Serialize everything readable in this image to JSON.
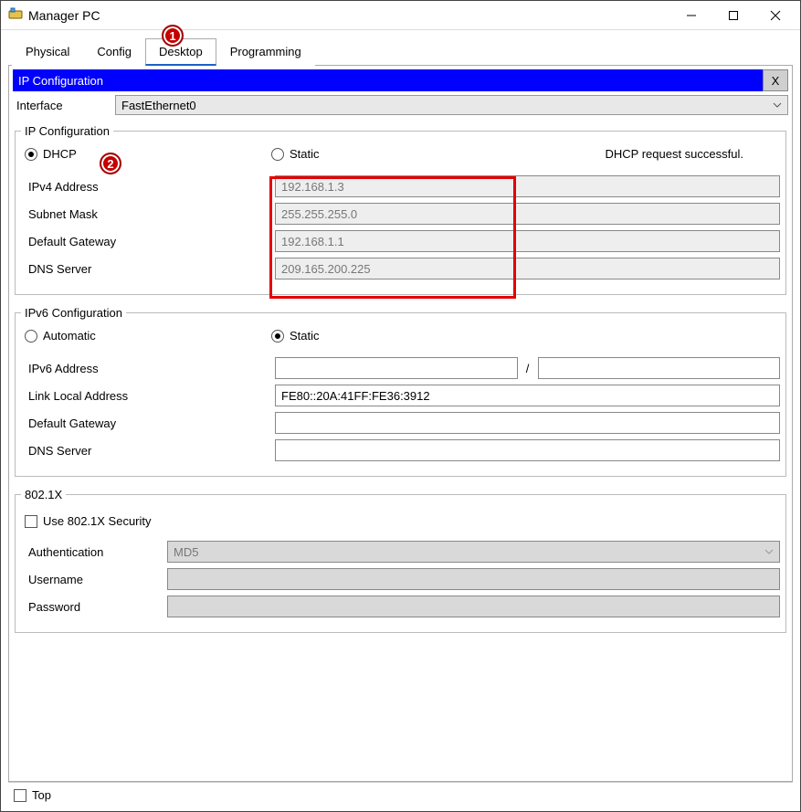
{
  "window": {
    "title": "Manager PC"
  },
  "tabs": {
    "items": [
      "Physical",
      "Config",
      "Desktop",
      "Programming"
    ],
    "active_index": 2
  },
  "bluebar": {
    "title": "IP Configuration",
    "close": "X"
  },
  "interface": {
    "label": "Interface",
    "value": "FastEthernet0"
  },
  "ipconfig": {
    "legend": "IP Configuration",
    "mode_dhcp": "DHCP",
    "mode_static": "Static",
    "mode_selected": "dhcp",
    "status": "DHCP request successful.",
    "fields": {
      "ipv4_label": "IPv4 Address",
      "ipv4_value": "192.168.1.3",
      "mask_label": "Subnet Mask",
      "mask_value": "255.255.255.0",
      "gw_label": "Default Gateway",
      "gw_value": "192.168.1.1",
      "dns_label": "DNS Server",
      "dns_value": "209.165.200.225"
    }
  },
  "ipv6": {
    "legend": "IPv6 Configuration",
    "mode_auto": "Automatic",
    "mode_static": "Static",
    "mode_selected": "static",
    "addr_label": "IPv6 Address",
    "addr_value": "",
    "addr_sep": "/",
    "addr_suffix": "",
    "ll_label": "Link Local Address",
    "ll_value": "FE80::20A:41FF:FE36:3912",
    "gw_label": "Default Gateway",
    "gw_value": "",
    "dns_label": "DNS Server",
    "dns_value": ""
  },
  "dot1x": {
    "legend": "802.1X",
    "use_label": "Use 802.1X Security",
    "auth_label": "Authentication",
    "auth_value": "MD5",
    "user_label": "Username",
    "user_value": "",
    "pass_label": "Password",
    "pass_value": ""
  },
  "bottom": {
    "top_label": "Top"
  },
  "callouts": {
    "one": "1",
    "two": "2"
  }
}
